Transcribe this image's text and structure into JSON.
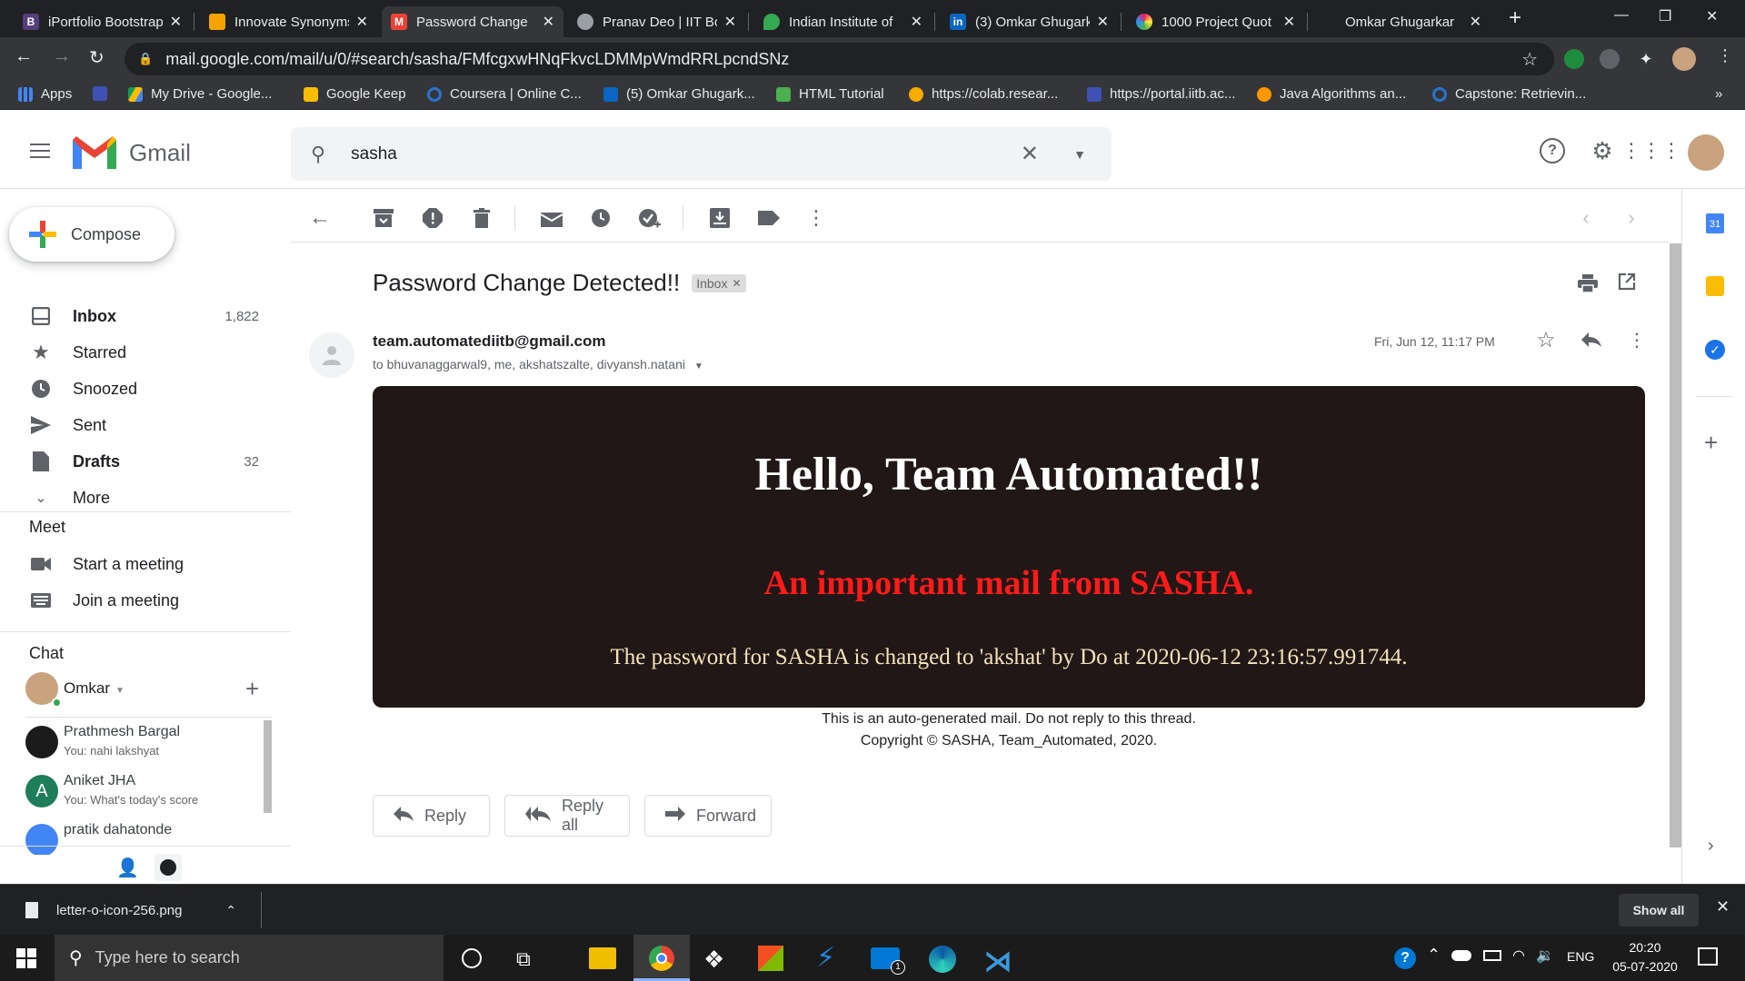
{
  "browser": {
    "tabs": [
      {
        "title": "iPortfolio Bootstrap",
        "favicon": "bootstrap-icon",
        "color": "#563d7c",
        "glyph": "B"
      },
      {
        "title": "Innovate Synonyms",
        "favicon": "thesaurus-icon",
        "color": "#f4a300",
        "glyph": ""
      },
      {
        "title": "Password Change",
        "favicon": "gmail-icon",
        "color": "#ea4335",
        "glyph": "M"
      },
      {
        "title": "Pranav Deo | IIT Bo",
        "favicon": "globe-icon",
        "color": "#9aa0a6",
        "glyph": ""
      },
      {
        "title": "Indian Institute of",
        "favicon": "maps-pin-icon",
        "color": "#34a853",
        "glyph": ""
      },
      {
        "title": "(3) Omkar Ghugark",
        "favicon": "linkedin-icon",
        "color": "#0a66c2",
        "glyph": "in"
      },
      {
        "title": "1000 Project Quot",
        "favicon": "pinwheel-icon",
        "color": "#e91e63",
        "glyph": ""
      },
      {
        "title": "Omkar Ghugarkar",
        "favicon": "blank-icon",
        "color": "#202124",
        "glyph": ""
      }
    ],
    "new_tab": "+",
    "url": "mail.google.com/mail/u/0/#search/sasha/FMfcgxwHNqFkvcLDMMpWmdRRLpcndSNz",
    "bookmarks": [
      {
        "label": "Apps",
        "icon": "apps-grid-icon",
        "color": "#4285f4"
      },
      {
        "label": "",
        "icon": "iitb-icon",
        "color": "#3f51b5"
      },
      {
        "label": "My Drive - Google...",
        "icon": "drive-icon",
        "color": "#fbbc04"
      },
      {
        "label": "Google Keep",
        "icon": "keep-icon",
        "color": "#fbbc04"
      },
      {
        "label": "Coursera | Online C...",
        "icon": "coursera-icon",
        "color": "#2a73cc"
      },
      {
        "label": "(5) Omkar Ghugark...",
        "icon": "linkedin-icon",
        "color": "#0a66c2"
      },
      {
        "label": "HTML Tutorial",
        "icon": "w3schools-icon",
        "color": "#4caf50"
      },
      {
        "label": "https://colab.resear...",
        "icon": "colab-icon",
        "color": "#f9ab00"
      },
      {
        "label": "https://portal.iitb.ac...",
        "icon": "iitb-icon",
        "color": "#3f51b5"
      },
      {
        "label": "Java Algorithms an...",
        "icon": "algorithm-icon",
        "color": "#ff9800"
      },
      {
        "label": "Capstone: Retrievin...",
        "icon": "coursera-icon",
        "color": "#2a73cc"
      }
    ],
    "bookmarks_overflow": "»"
  },
  "gmail": {
    "logo_text": "Gmail",
    "search_query": "sasha",
    "compose_label": "Compose",
    "nav": [
      {
        "label": "Inbox",
        "count": "1,822",
        "icon": "inbox-icon",
        "bold": true
      },
      {
        "label": "Starred",
        "count": "",
        "icon": "star-icon",
        "bold": false
      },
      {
        "label": "Snoozed",
        "count": "",
        "icon": "clock-icon",
        "bold": false
      },
      {
        "label": "Sent",
        "count": "",
        "icon": "send-icon",
        "bold": false
      },
      {
        "label": "Drafts",
        "count": "32",
        "icon": "draft-icon",
        "bold": true
      },
      {
        "label": "More",
        "count": "",
        "icon": "chevron-down-icon",
        "bold": false
      }
    ],
    "meet": {
      "heading": "Meet",
      "items": [
        {
          "label": "Start a meeting",
          "icon": "video-camera-icon"
        },
        {
          "label": "Join a meeting",
          "icon": "keyboard-icon"
        }
      ]
    },
    "chat": {
      "heading": "Chat",
      "self_name": "Omkar",
      "contacts": [
        {
          "name": "Prathmesh Bargal",
          "snippet": "You: nahi lakshyat",
          "avatar_color": "#1b1b1b",
          "initial": ""
        },
        {
          "name": "Aniket JHA",
          "snippet": "You: What's today's score",
          "avatar_color": "#1e7d5a",
          "initial": "A"
        },
        {
          "name": "pratik dahatonde",
          "snippet": "",
          "avatar_color": "#4285f4",
          "initial": ""
        }
      ]
    },
    "message": {
      "subject": "Password Change Detected!!",
      "label_chip": "Inbox",
      "sender": "team.automatediitb@gmail.com",
      "recipients": "to bhuvanaggarwal9, me, akshatszalte, divyansh.natani",
      "date": "Fri, Jun 12, 11:17 PM",
      "body": {
        "heading": "Hello, Team Automated!!",
        "subheading": "An important mail from SASHA.",
        "paragraph": "The password for SASHA is changed to 'akshat' by Do at 2020-06-12 23:16:57.991744."
      },
      "footer_line1": "This is an auto-generated mail. Do not reply to this thread.",
      "footer_line2": "Copyright © SASHA, Team_Automated, 2020."
    },
    "actions": {
      "reply": "Reply",
      "reply_all": "Reply all",
      "forward": "Forward"
    }
  },
  "downloads": {
    "file_name": "letter-o-icon-256.png",
    "show_all": "Show all"
  },
  "taskbar": {
    "search_placeholder": "Type here to search",
    "language": "ENG",
    "time": "20:20",
    "date": "05-07-2020",
    "mail_badge": "1"
  }
}
